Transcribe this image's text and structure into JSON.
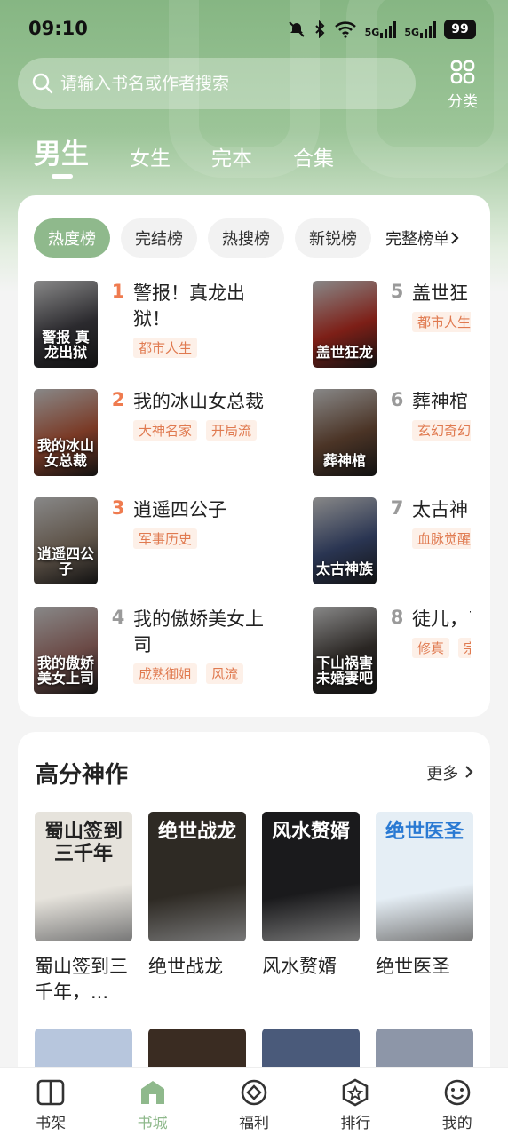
{
  "status": {
    "time": "09:10",
    "sig1": "5G",
    "sig2": "5G",
    "battery": "99"
  },
  "search": {
    "placeholder": "请输入书名或作者搜索"
  },
  "category": {
    "label": "分类"
  },
  "tabs": [
    "男生",
    "女生",
    "完本",
    "合集"
  ],
  "chips": [
    "热度榜",
    "完结榜",
    "热搜榜",
    "新锐榜",
    "完整榜单"
  ],
  "ranking": [
    {
      "num": "1",
      "title": "警报！真龙出狱！",
      "tags": [
        "都市人生"
      ],
      "cover_text": "警报 真龙出狱",
      "cover_color": "#2b2a2e",
      "num_color": "#ef7b4f"
    },
    {
      "num": "2",
      "title": "我的冰山女总裁",
      "tags": [
        "大神名家",
        "开局流"
      ],
      "cover_text": "我的冰山女总裁",
      "cover_color": "#7a3a26",
      "num_color": "#ef7b4f"
    },
    {
      "num": "3",
      "title": "逍遥四公子",
      "tags": [
        "军事历史"
      ],
      "cover_text": "逍遥四公子",
      "cover_color": "#5e5348",
      "num_color": "#ef7b4f"
    },
    {
      "num": "4",
      "title": "我的傲娇美女上司",
      "tags": [
        "成熟御姐",
        "风流"
      ],
      "cover_text": "我的傲娇美女上司",
      "cover_color": "#6b4a46",
      "num_color": "#9a9a9a"
    },
    {
      "num": "5",
      "title": "盖世狂",
      "tags": [
        "都市人生"
      ],
      "cover_text": "盖世狂龙",
      "cover_color": "#7d1f17",
      "num_color": "#9a9a9a"
    },
    {
      "num": "6",
      "title": "葬神棺",
      "tags": [
        "玄幻奇幻"
      ],
      "cover_text": "葬神棺",
      "cover_color": "#4b3426",
      "num_color": "#9a9a9a"
    },
    {
      "num": "7",
      "title": "太古神",
      "tags": [
        "血脉觉醒"
      ],
      "cover_text": "太古神族",
      "cover_color": "#2a3552",
      "num_color": "#9a9a9a"
    },
    {
      "num": "8",
      "title": "徒儿，了，下",
      "tags": [
        "修真",
        "宗"
      ],
      "cover_text": "下山祸害未婚妻吧",
      "cover_color": "#2a2623",
      "num_color": "#9a9a9a"
    }
  ],
  "section": {
    "title": "高分神作",
    "more": "更多"
  },
  "books": [
    {
      "title": "蜀山签到三千年，...",
      "cover_text": "蜀山签到三千年",
      "cover_color": "#e6e3dc",
      "text_color": "#222"
    },
    {
      "title": "绝世战龙",
      "cover_text": "绝世战龙",
      "cover_color": "#2e2a24",
      "text_color": "#fff"
    },
    {
      "title": "风水赘婿",
      "cover_text": "风水赘婿",
      "cover_color": "#1a1a1c",
      "text_color": "#fff"
    },
    {
      "title": "绝世医圣",
      "cover_text": "绝世医圣",
      "cover_color": "#e5eef5",
      "text_color": "#2a7ad3"
    }
  ],
  "books_row2_colors": [
    "#b7c6dd",
    "#3a2c22",
    "#4a5a7a",
    "#8d96a8"
  ],
  "nav": [
    {
      "label": "书架"
    },
    {
      "label": "书城"
    },
    {
      "label": "福利"
    },
    {
      "label": "排行"
    },
    {
      "label": "我的"
    }
  ]
}
